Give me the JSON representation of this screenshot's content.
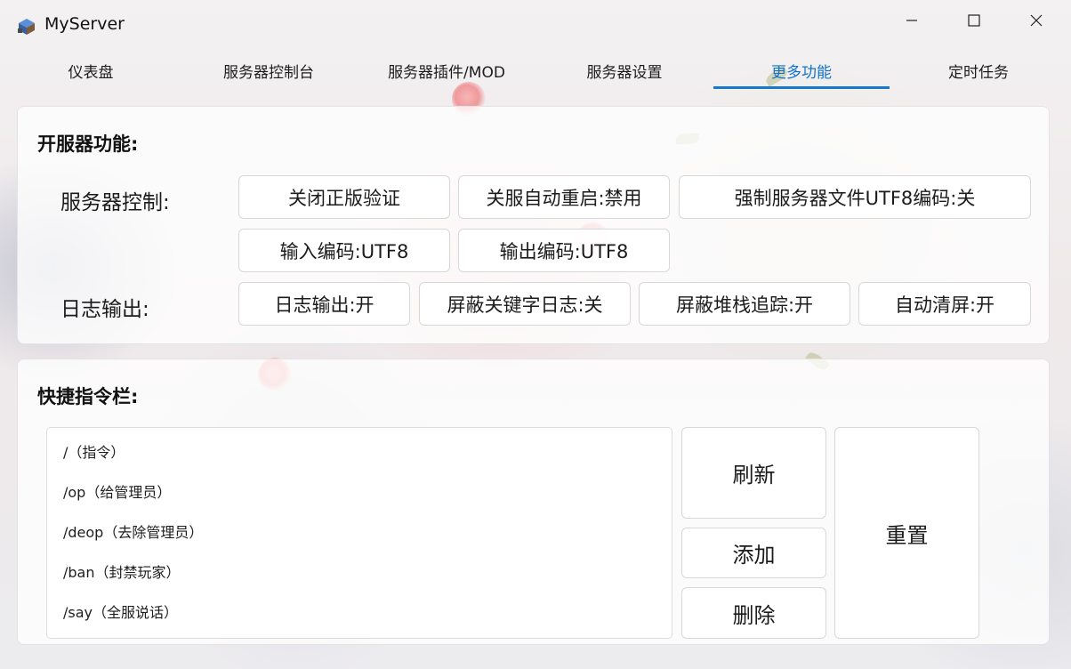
{
  "window": {
    "title": "MyServer",
    "icon": "server-app-icon",
    "controls": [
      "minimize-icon",
      "maximize-icon",
      "close-icon"
    ]
  },
  "tabs": [
    {
      "label": "仪表盘"
    },
    {
      "label": "服务器控制台"
    },
    {
      "label": "服务器插件/MOD"
    },
    {
      "label": "服务器设置"
    },
    {
      "label": "更多功能",
      "active": true
    },
    {
      "label": "定时任务"
    }
  ],
  "server_features": {
    "title": "开服器功能:",
    "control_label": "服务器控制:",
    "control_buttons": [
      "关闭正版验证",
      "关服自动重启:禁用",
      "强制服务器文件UTF8编码:关",
      "输入编码:UTF8",
      "输出编码:UTF8"
    ],
    "log_label": "日志输出:",
    "log_buttons": [
      "日志输出:开",
      "屏蔽关键字日志:关",
      "屏蔽堆栈追踪:开",
      "自动清屏:开"
    ]
  },
  "quick_commands": {
    "title": "快捷指令栏:",
    "items": [
      "/（指令）",
      "/op（给管理员）",
      "/deop（去除管理员）",
      "/ban（封禁玩家）",
      "/say（全服说话）"
    ],
    "refresh_label": "刷新",
    "add_label": "添加",
    "delete_label": "删除",
    "reset_label": "重置"
  },
  "colors": {
    "accent": "#1a78c9",
    "active_tab_text": "#1173c8"
  }
}
